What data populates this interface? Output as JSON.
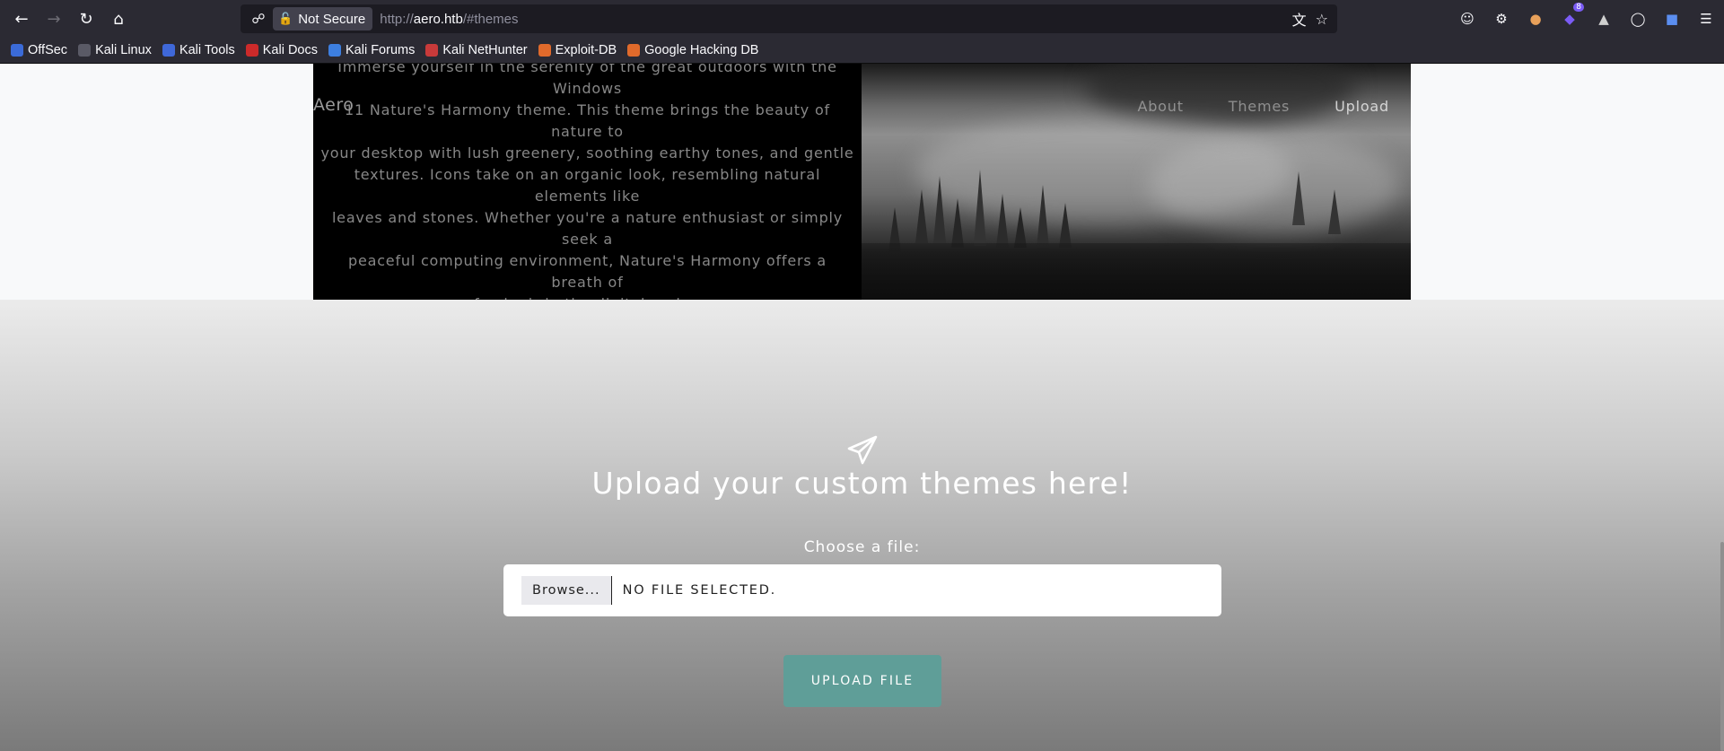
{
  "browser": {
    "not_secure_label": "Not Secure",
    "url_prefix": "http://",
    "url_host": "aero.htb",
    "url_path": "/#themes",
    "extension_badge": "8",
    "bookmarks": [
      {
        "label": "OffSec",
        "color": "#3b6bd8"
      },
      {
        "label": "Kali Linux",
        "color": "#2b2a33"
      },
      {
        "label": "Kali Tools",
        "color": "#3f68d9"
      },
      {
        "label": "Kali Docs",
        "color": "#cc2a2a"
      },
      {
        "label": "Kali Forums",
        "color": "#3d7fe0"
      },
      {
        "label": "Kali NetHunter",
        "color": "#c83a3a"
      },
      {
        "label": "Exploit-DB",
        "color": "#e06a2b"
      },
      {
        "label": "Google Hacking DB",
        "color": "#e06a2b"
      }
    ]
  },
  "page": {
    "brand": "Aero",
    "nav": {
      "about": "About",
      "themes": "Themes",
      "upload": "Upload"
    },
    "theme_description_lines": [
      "Immerse yourself in the serenity of the great outdoors with the Windows",
      "11 Nature's Harmony theme. This theme brings the beauty of nature to",
      "your desktop with lush greenery, soothing earthy tones, and gentle",
      "textures. Icons take on an organic look, resembling natural elements like",
      "leaves and stones. Whether you're a nature enthusiast or simply seek a",
      "peaceful computing environment, Nature's Harmony offers a breath of",
      "fresh air in the digital realm."
    ],
    "upload": {
      "icon": "paper-plane-icon",
      "title": "Upload your custom themes here!",
      "choose_label": "Choose a file:",
      "browse_label": "Browse...",
      "no_file_label": "NO FILE SELECTED.",
      "upload_button": "UPLOAD FILE",
      "accent_color": "#5f9e98"
    }
  }
}
